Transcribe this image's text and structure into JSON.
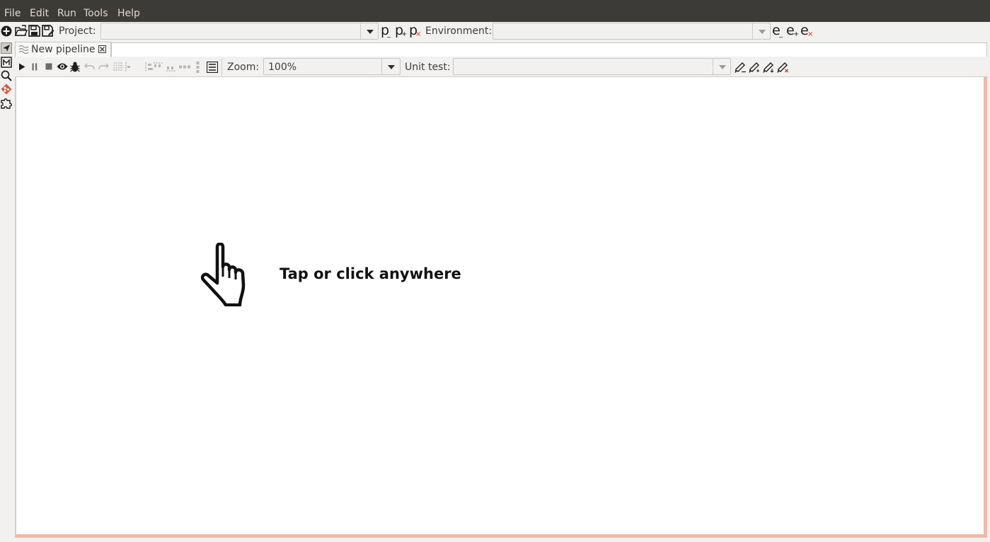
{
  "menubar": {
    "items": [
      {
        "label": "File"
      },
      {
        "label": "Edit"
      },
      {
        "label": "Run"
      },
      {
        "label": "Tools"
      },
      {
        "label": "Help"
      }
    ]
  },
  "main_toolbar": {
    "icons": [
      "new-icon",
      "open-icon",
      "save-icon",
      "save-as-icon"
    ],
    "project_label": "Project:",
    "project_value": "",
    "project_buttons": [
      {
        "letter": "p",
        "sub": "_",
        "icon": "edit-project-icon"
      },
      {
        "letter": "p",
        "sub": "+",
        "icon": "add-project-icon"
      },
      {
        "letter": "p",
        "sub": "×",
        "icon": "delete-project-icon"
      }
    ],
    "environment_label": "Environment:",
    "environment_value": "",
    "environment_buttons": [
      {
        "letter": "e",
        "sub": "_",
        "icon": "edit-environment-icon"
      },
      {
        "letter": "e",
        "sub": "+",
        "icon": "add-environment-icon"
      },
      {
        "letter": "e",
        "sub": "×",
        "icon": "delete-environment-icon"
      }
    ]
  },
  "left_strip": {
    "icons": [
      "pipeline-perspective-icon",
      "metadata-perspective-icon",
      "search-icon",
      "git-icon",
      "plugin-icon"
    ]
  },
  "tabs": [
    {
      "label": "New pipeline",
      "icon": "pipeline-icon",
      "close_icon": "close-icon"
    }
  ],
  "pipeline_toolbar": {
    "icons": [
      "run-icon",
      "pause-icon",
      "stop-icon",
      "preview-icon",
      "debug-icon",
      "undo-icon",
      "redo-icon",
      "snap-to-grid-icon",
      "align-left-icon",
      "align-right-icon",
      "align-top-icon",
      "align-bottom-icon",
      "distribute-horizontal-icon",
      "distribute-vertical-icon",
      "toggle-panel-icon"
    ],
    "zoom_label": "Zoom:",
    "zoom_value": "100%",
    "unit_test_label": "Unit test:",
    "unit_test_value": "",
    "unit_test_icons": [
      "edit-unit-test-icon",
      "add-unit-test-icon",
      "add-unit-test-alt-icon",
      "delete-unit-test-icon"
    ]
  },
  "canvas": {
    "hint": "Tap or click anywhere",
    "hint_icon": "pointing-hand-icon"
  },
  "colors": {
    "menubar_bg": "#3c3b37",
    "canvas_border_accent": "#f1b9a8"
  }
}
